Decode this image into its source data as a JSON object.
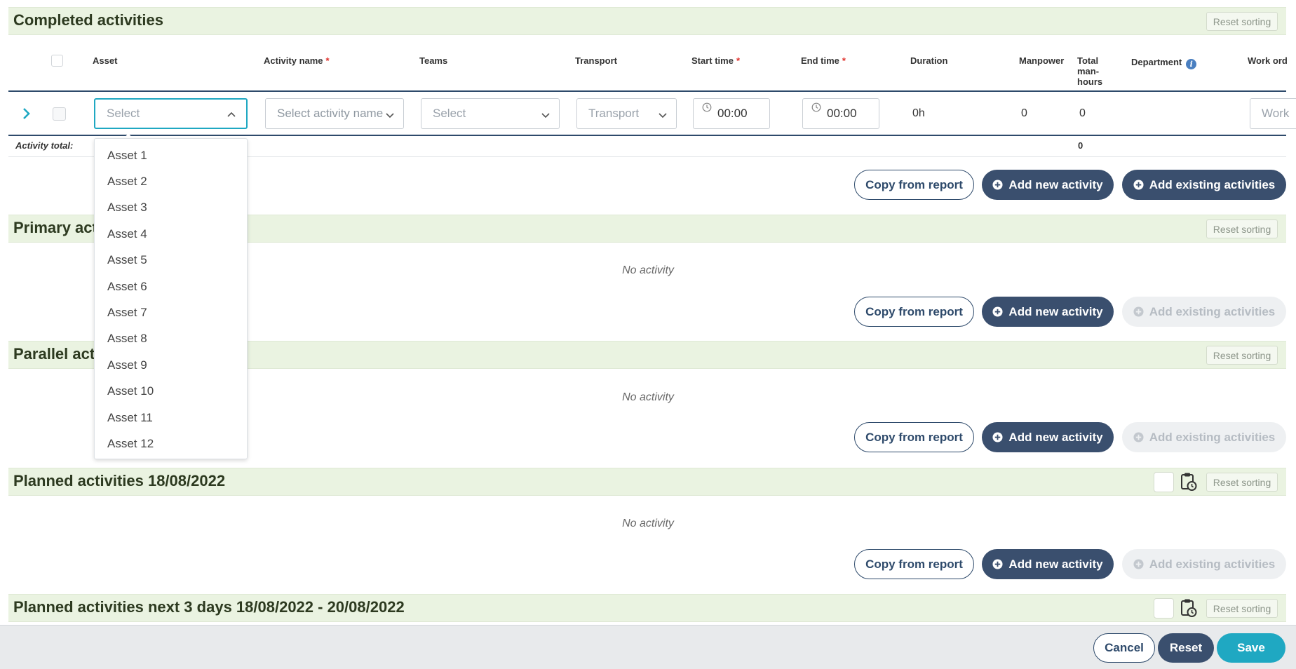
{
  "sections": {
    "completed": {
      "title": "Completed activities",
      "reset": "Reset sorting"
    },
    "primary": {
      "title": "Primary act",
      "reset": "Reset sorting",
      "empty": "No activity"
    },
    "parallel": {
      "title": "Parallel acti",
      "reset": "Reset sorting",
      "empty": "No activity"
    },
    "planned": {
      "title": "Planned activities 18/08/2022",
      "reset": "Reset sorting",
      "empty": "No activity"
    },
    "planned_next": {
      "title": "Planned activities next 3 days 18/08/2022 - 20/08/2022",
      "reset": "Reset sorting"
    }
  },
  "table": {
    "columns": {
      "asset": "Asset",
      "activity_name": "Activity name",
      "teams": "Teams",
      "transport": "Transport",
      "start_time": "Start time",
      "end_time": "End time",
      "duration": "Duration",
      "manpower": "Manpower",
      "total_1": "Total",
      "total_2": "man-",
      "total_3": "hours",
      "department": "Department",
      "work_order": "Work ord"
    },
    "required_mark": "*",
    "info_glyph": "i",
    "row": {
      "asset_placeholder": "Select",
      "activity_placeholder": "Select activity name",
      "teams_placeholder": "Select",
      "transport_placeholder": "Transport",
      "start_time": "00:00",
      "end_time": "00:00",
      "duration": "0h",
      "manpower": "0",
      "total_manhours": "0",
      "work_order_placeholder": "Work"
    },
    "total_label": "Activity total:",
    "total_value": "0"
  },
  "buttons": {
    "copy": "Copy from report",
    "add_new": "Add new activity",
    "add_existing": "Add existing activities"
  },
  "dropdown": {
    "items": [
      "Asset 1",
      "Asset 2",
      "Asset 3",
      "Asset 4",
      "Asset 5",
      "Asset 6",
      "Asset 7",
      "Asset 8",
      "Asset 9",
      "Asset 10",
      "Asset 11",
      "Asset 12"
    ]
  },
  "footer": {
    "cancel": "Cancel",
    "reset": "Reset",
    "save": "Save"
  },
  "colors": {
    "section_bg": "#eaf3e1",
    "primary_dark": "#3a4f6e",
    "accent_teal": "#1fa8c2",
    "required_red": "#e0302b"
  }
}
